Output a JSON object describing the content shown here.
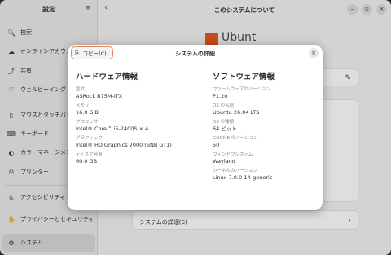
{
  "sidebar": {
    "title": "設定",
    "menu_icon": "hamburger-icon",
    "items": [
      {
        "label": "検索",
        "icon": "search-icon",
        "glyph": "🔍"
      },
      {
        "label": "オンラインアカウント",
        "icon": "cloud-icon",
        "glyph": "☁"
      },
      {
        "label": "共有",
        "icon": "share-icon",
        "glyph": "⤴"
      },
      {
        "label": "ウェルビーイング",
        "icon": "wellbeing-icon",
        "glyph": "♡"
      },
      {
        "label": "マウスとタッチパッド",
        "icon": "mouse-icon",
        "glyph": "▯"
      },
      {
        "label": "キーボード",
        "icon": "keyboard-icon",
        "glyph": "⌨"
      },
      {
        "label": "カラーマネージメント",
        "icon": "color-icon",
        "glyph": "◐"
      },
      {
        "label": "プリンター",
        "icon": "printer-icon",
        "glyph": "⎙"
      },
      {
        "label": "アクセシビリティ",
        "icon": "accessibility-icon",
        "glyph": "♿"
      },
      {
        "label": "プライバシーとセキュリティ",
        "icon": "privacy-icon",
        "glyph": "✋"
      },
      {
        "label": "システム",
        "icon": "system-icon",
        "glyph": "⚙"
      }
    ]
  },
  "main": {
    "title": "このシステムについて",
    "logo_text": "Ubunt",
    "details_row": "システムの詳細(S)"
  },
  "dialog": {
    "title": "システムの詳細",
    "copy_label": "コピー(C)",
    "hardware": {
      "heading": "ハードウェア情報",
      "fields": [
        {
          "label": "型式",
          "value": "ASRock B75M-ITX"
        },
        {
          "label": "メモリ",
          "value": "16.0 GiB"
        },
        {
          "label": "プロセッサー",
          "value": "Intel® Core™ i5-2400S × 4"
        },
        {
          "label": "グラフィック",
          "value": "Intel® HD Graphics 2000 (SNB GT1)"
        },
        {
          "label": "ディスク容量",
          "value": "60.0 GB"
        }
      ]
    },
    "software": {
      "heading": "ソフトウェア情報",
      "fields": [
        {
          "label": "ファームウェアのバージョン",
          "value": "P1.20"
        },
        {
          "label": "OS の名前",
          "value": "Ubuntu 26.04 LTS"
        },
        {
          "label": "OS の種類",
          "value": "64 ビット"
        },
        {
          "label": "GNOME のバージョン",
          "value": "50"
        },
        {
          "label": "ウィンドウシステム",
          "value": "Wayland"
        },
        {
          "label": "カーネルのバージョン",
          "value": "Linux 7.0.0-14-generic"
        }
      ]
    }
  },
  "colors": {
    "accent": "#e95420",
    "copy_border": "#e8845e"
  }
}
